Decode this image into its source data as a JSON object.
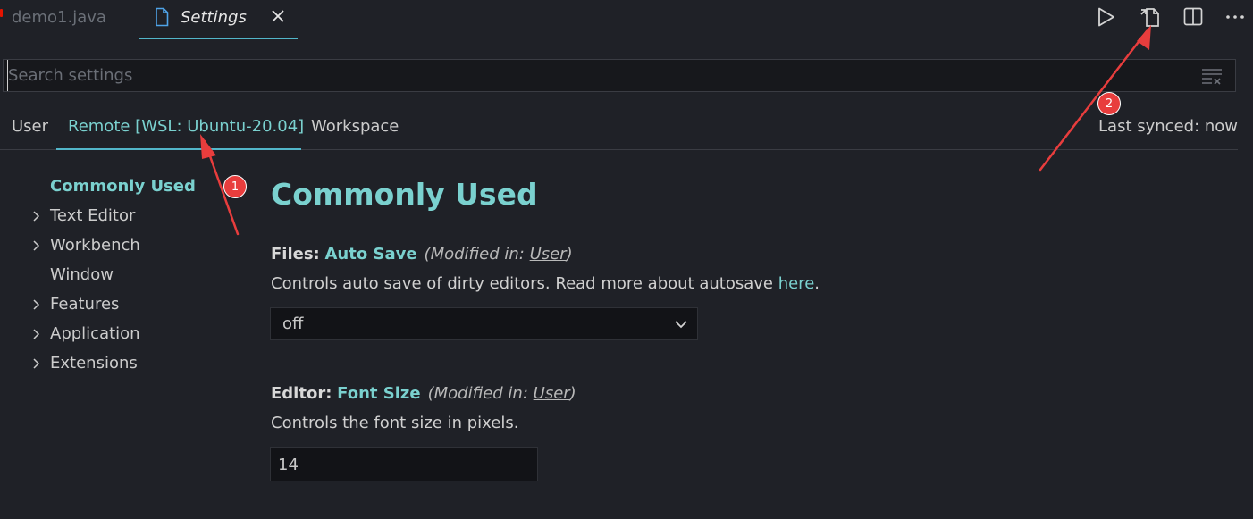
{
  "tabs": [
    {
      "label": "demo1.java"
    },
    {
      "label": "Settings",
      "active": true
    }
  ],
  "search": {
    "placeholder": "Search settings"
  },
  "scope_tabs": [
    {
      "label": "User"
    },
    {
      "label": "Remote [WSL: Ubuntu-20.04]",
      "active": true
    },
    {
      "label": "Workspace"
    }
  ],
  "sync_status": "Last synced: now",
  "toc": [
    {
      "label": "Commonly Used",
      "active": true
    },
    {
      "label": "Text Editor",
      "expandable": true
    },
    {
      "label": "Workbench",
      "expandable": true
    },
    {
      "label": "Window"
    },
    {
      "label": "Features",
      "expandable": true
    },
    {
      "label": "Application",
      "expandable": true
    },
    {
      "label": "Extensions",
      "expandable": true
    }
  ],
  "section_title": "Commonly Used",
  "settings": [
    {
      "category": "Files:",
      "name": "Auto Save",
      "modified_prefix": "(Modified in:",
      "modified_link": "User",
      "modified_suffix": ")",
      "description": "Controls auto save of dirty editors. Read more about autosave ",
      "description_link": "here",
      "description_suffix": ".",
      "value": "off"
    },
    {
      "category": "Editor:",
      "name": "Font Size",
      "modified_prefix": "(Modified in:",
      "modified_link": "User",
      "modified_suffix": ")",
      "description": "Controls the font size in pixels.",
      "value": "14"
    }
  ],
  "annotations": [
    {
      "label": "1"
    },
    {
      "label": "2"
    }
  ],
  "colors": {
    "background": "#1f2127",
    "accent": "#7ad1cf",
    "tab_underline": "#52b6c9",
    "annotation": "#e83d3d"
  },
  "icons": {
    "toolbar": [
      "run-icon",
      "open-settings-json-icon",
      "split-editor-icon",
      "more-actions-icon"
    ]
  }
}
